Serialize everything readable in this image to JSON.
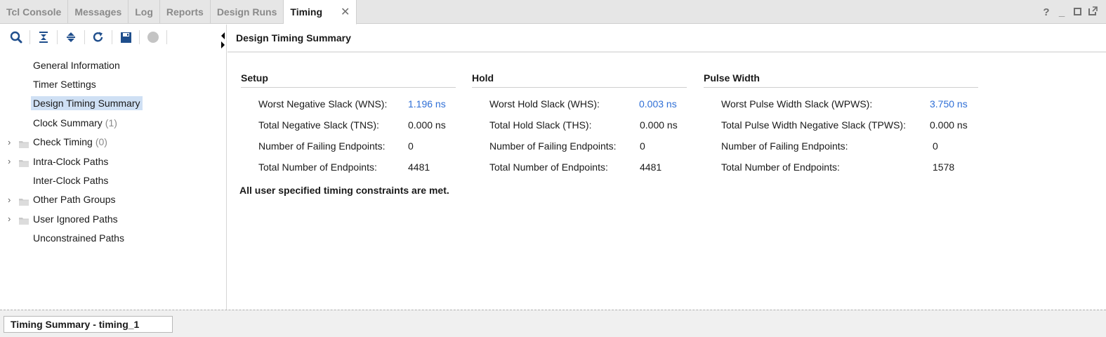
{
  "tabs": [
    {
      "label": "Tcl Console"
    },
    {
      "label": "Messages"
    },
    {
      "label": "Log"
    },
    {
      "label": "Reports"
    },
    {
      "label": "Design Runs"
    },
    {
      "label": "Timing",
      "active": true
    }
  ],
  "window_controls": {
    "help": "?",
    "minimize": "_"
  },
  "toolbar_icons": [
    "search-icon",
    "collapse-all-icon",
    "expand-all-icon",
    "refresh-icon",
    "save-icon",
    "stop-icon"
  ],
  "tree": [
    {
      "label": "General Information",
      "count": ""
    },
    {
      "label": "Timer Settings",
      "count": ""
    },
    {
      "label": "Design Timing Summary",
      "count": "",
      "selected": true
    },
    {
      "label": "Clock Summary",
      "count": "(1)"
    },
    {
      "label": "Check Timing",
      "count": "(0)",
      "expandable": true
    },
    {
      "label": "Intra-Clock Paths",
      "count": "",
      "expandable": true
    },
    {
      "label": "Inter-Clock Paths",
      "count": ""
    },
    {
      "label": "Other Path Groups",
      "count": "",
      "expandable": true
    },
    {
      "label": "User Ignored Paths",
      "count": "",
      "expandable": true
    },
    {
      "label": "Unconstrained Paths",
      "count": ""
    }
  ],
  "main": {
    "title": "Design Timing Summary",
    "setup": {
      "title": "Setup",
      "rows": [
        {
          "k": "Worst Negative Slack (WNS):",
          "v": "1.196 ns",
          "link": true
        },
        {
          "k": "Total Negative Slack (TNS):",
          "v": "0.000 ns"
        },
        {
          "k": "Number of Failing Endpoints:",
          "v": "0"
        },
        {
          "k": "Total Number of Endpoints:",
          "v": "4481"
        }
      ]
    },
    "hold": {
      "title": "Hold",
      "rows": [
        {
          "k": "Worst Hold Slack (WHS):",
          "v": "0.003 ns",
          "link": true
        },
        {
          "k": "Total Hold Slack (THS):",
          "v": "0.000 ns"
        },
        {
          "k": "Number of Failing Endpoints:",
          "v": "0"
        },
        {
          "k": "Total Number of Endpoints:",
          "v": "4481"
        }
      ]
    },
    "pulse": {
      "title": "Pulse Width",
      "rows": [
        {
          "k": "Worst Pulse Width Slack (WPWS):",
          "v": "3.750 ns",
          "link": true
        },
        {
          "k": "Total Pulse Width Negative Slack (TPWS):",
          "v": "0.000 ns"
        },
        {
          "k": "Number of Failing Endpoints:",
          "v": "0"
        },
        {
          "k": "Total Number of Endpoints:",
          "v": "1578"
        }
      ]
    },
    "note": "All user specified timing constraints are met."
  },
  "bottom_tab": "Timing Summary - timing_1",
  "colors": {
    "link": "#2f6fd6",
    "selection": "#cfe0f4",
    "icon": "#1f4e8c"
  }
}
